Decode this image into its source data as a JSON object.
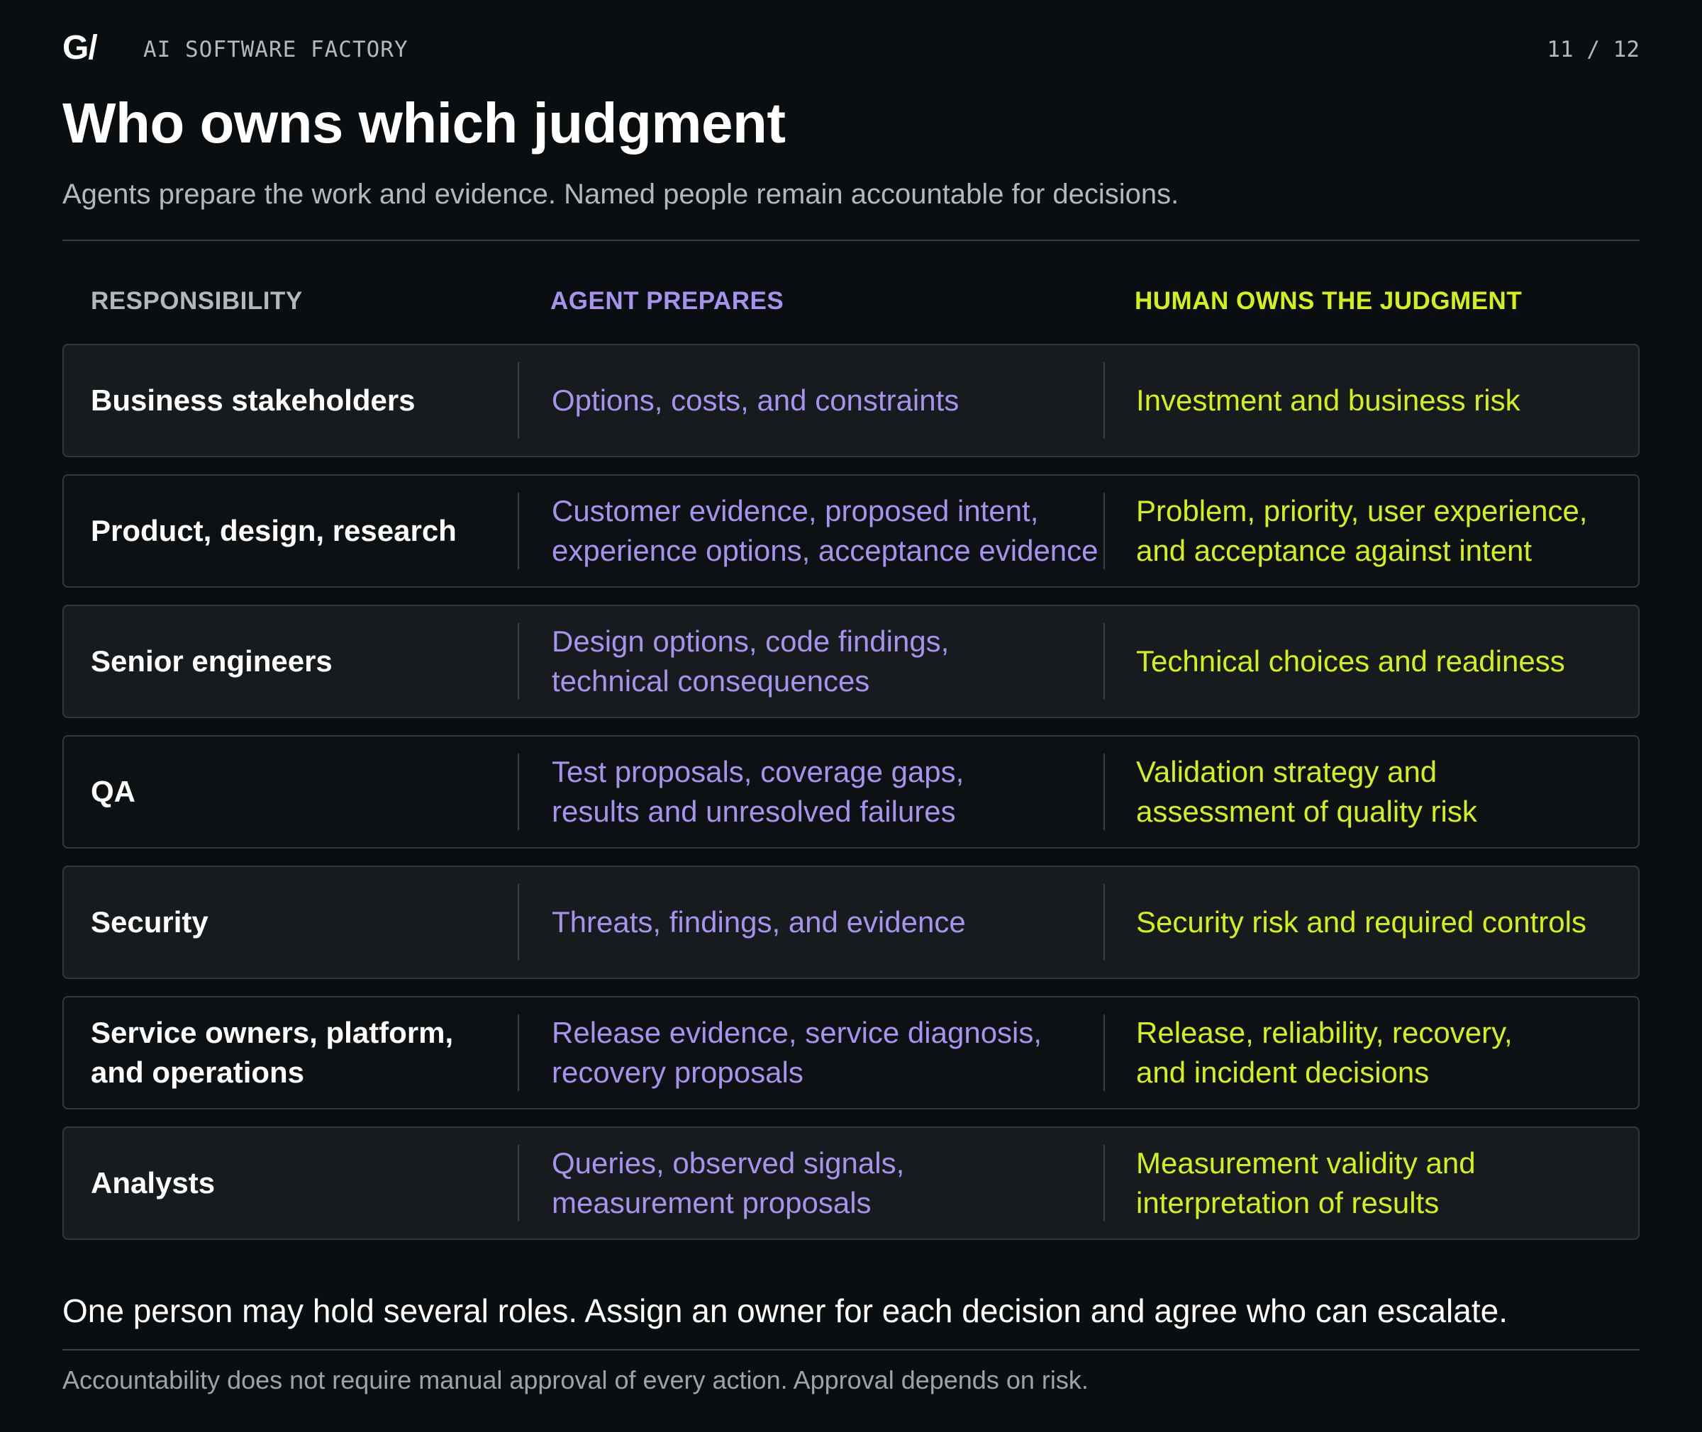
{
  "header": {
    "logo": "G/",
    "brand": "AI SOFTWARE FACTORY",
    "page_indicator": "11 / 12"
  },
  "title": "Who owns which judgment",
  "subtitle": "Agents prepare the work and evidence. Named people remain accountable for decisions.",
  "table": {
    "columns": {
      "responsibility": "RESPONSIBILITY",
      "agent": "AGENT PREPARES",
      "human": "HUMAN OWNS THE JUDGMENT"
    },
    "rows": [
      {
        "responsibility": "Business stakeholders",
        "agent": "Options, costs, and constraints",
        "human": "Investment and business risk"
      },
      {
        "responsibility": "Product, design, research",
        "agent": "Customer evidence, proposed intent,\nexperience options, acceptance evidence",
        "human": "Problem, priority, user experience,\nand acceptance against intent"
      },
      {
        "responsibility": "Senior engineers",
        "agent": "Design options, code findings,\ntechnical consequences",
        "human": "Technical choices and readiness"
      },
      {
        "responsibility": "QA",
        "agent": "Test proposals, coverage gaps,\nresults and unresolved failures",
        "human": "Validation strategy and\nassessment of quality risk"
      },
      {
        "responsibility": "Security",
        "agent": "Threats, findings, and evidence",
        "human": "Security risk and required controls"
      },
      {
        "responsibility": "Service owners, platform,\nand operations",
        "agent": "Release evidence, service diagnosis,\nrecovery proposals",
        "human": "Release, reliability, recovery,\nand incident decisions"
      },
      {
        "responsibility": "Analysts",
        "agent": "Queries, observed signals,\nmeasurement proposals",
        "human": "Measurement validity and\ninterpretation of results"
      }
    ]
  },
  "note": "One person may hold several roles. Assign an owner for each decision and agree who can escalate.",
  "footnote": "Accountability does not require manual approval of every action. Approval depends on risk.",
  "colors": {
    "background": "#0b0e10",
    "agent_accent": "#a792ee",
    "human_accent": "#d4f018",
    "muted_text": "#b4b8bb"
  }
}
